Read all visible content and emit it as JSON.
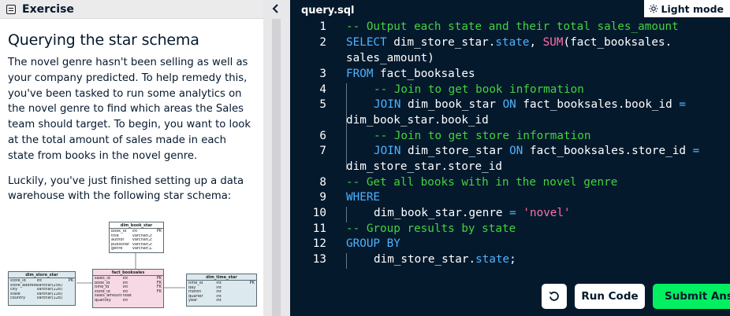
{
  "exercise": {
    "header_label": "Exercise",
    "title": "Querying the star schema",
    "paragraph1": "The novel genre hasn't been selling as well as your company predicted. To help remedy this, you've been tasked to run some analytics on the novel genre to find which areas the Sales team should target. To begin, you want to look at the total amount of sales made in each state from books in the novel genre.",
    "paragraph2": "Luckily, you've just finished setting up a data warehouse with the following star schema:"
  },
  "schema": {
    "dim_book_star": {
      "name": "dim_book_star",
      "rows": [
        [
          "book_id",
          "int",
          "PK"
        ],
        [
          "title",
          "varchar(256)",
          ""
        ],
        [
          "author",
          "varchar(256)",
          ""
        ],
        [
          "publisher",
          "varchar(256)",
          ""
        ],
        [
          "genre",
          "varchar(128)",
          ""
        ]
      ]
    },
    "dim_store_star": {
      "name": "dim_store_star",
      "rows": [
        [
          "store_id",
          "int",
          "PK"
        ],
        [
          "store_address",
          "varchar(256)",
          ""
        ],
        [
          "city",
          "varchar(128)",
          ""
        ],
        [
          "state",
          "varchar(128)",
          ""
        ],
        [
          "country",
          "varchar(128)",
          ""
        ]
      ]
    },
    "fact_booksales": {
      "name": "fact_booksales",
      "rows": [
        [
          "sales_id",
          "int",
          "PK"
        ],
        [
          "book_id",
          "int",
          "FK"
        ],
        [
          "time_id",
          "int",
          "FK"
        ],
        [
          "store_id",
          "int",
          "FK"
        ],
        [
          "sales_amount",
          "float",
          ""
        ],
        [
          "quantity",
          "int",
          ""
        ]
      ]
    },
    "dim_time_star": {
      "name": "dim_time_star",
      "rows": [
        [
          "time_id",
          "int",
          "PK"
        ],
        [
          "day",
          "int",
          ""
        ],
        [
          "month",
          "int",
          ""
        ],
        [
          "quarter",
          "int",
          ""
        ],
        [
          "year",
          "int",
          ""
        ]
      ]
    }
  },
  "editor": {
    "tab_label": "query.sql",
    "light_mode_label": "Light mode",
    "line_numbers": [
      "1",
      "2",
      "3",
      "4",
      "5",
      "6",
      "7",
      "8",
      "9",
      "10",
      "11",
      "12",
      "13"
    ],
    "code": {
      "l1": "-- Output each state and their total sales_amount",
      "l2_kw": "SELECT",
      "l2_a": " dim_store_star.",
      "l2_state": "state",
      "l2_b": ", ",
      "l2_fn": "SUM",
      "l2_c": "(fact_booksales.",
      "l2_wrap": "sales_amount)",
      "l3_kw": "FROM",
      "l3_a": " fact_booksales",
      "l4": "-- Join to get book information",
      "l5_kw": "JOIN",
      "l5_a": " dim_book_star ",
      "l5_on": "ON",
      "l5_b": " fact_booksales.book_id ",
      "l5_eq": "=",
      "l5_wrap": "dim_book_star.book_id",
      "l6": "-- Join to get store information",
      "l7_kw": "JOIN",
      "l7_a": " dim_store_star ",
      "l7_on": "ON",
      "l7_b": " fact_booksales.store_id ",
      "l7_eq": "=",
      "l7_wrap": "dim_store_star.store_id",
      "l8": "-- Get all books with in the novel genre",
      "l9_kw": "WHERE",
      "l10_a": "dim_book_star.genre ",
      "l10_eq": "=",
      "l10_sp": " ",
      "l10_str": "'novel'",
      "l11": "-- Group results by state",
      "l12_kw": "GROUP BY",
      "l13_a": "dim_store_star.",
      "l13_state": "state",
      "l13_b": ";"
    }
  },
  "actions": {
    "run_label": "Run Code",
    "submit_label": "Submit Answer"
  },
  "colors": {
    "editor_bg": "#05192d",
    "keyword": "#4fb2ff",
    "comment": "#42d33c",
    "function": "#ff6ea9",
    "submit": "#03ef62"
  }
}
